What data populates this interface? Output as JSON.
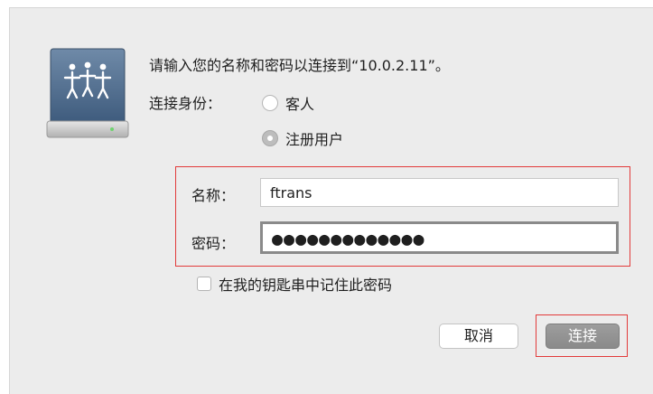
{
  "dialog": {
    "message": "请输入您的名称和密码以连接到“10.0.2.11”。",
    "connect_as_label": "连接身份：",
    "radio_options": [
      {
        "label": "客人",
        "checked": false
      },
      {
        "label": "注册用户",
        "checked": true
      }
    ],
    "name_label": "名称：",
    "name_value": "ftrans",
    "password_label": "密码：",
    "password_value": "●●●●●●●●●●●●●",
    "remember_label": "在我的钥匙串中记住此密码",
    "remember_checked": false,
    "cancel_label": "取消",
    "connect_label": "连接"
  },
  "icon": "network-server-icon",
  "colors": {
    "dialog_bg": "#ececec",
    "highlight_border": "#e23a3a",
    "connect_button": "#939393"
  }
}
